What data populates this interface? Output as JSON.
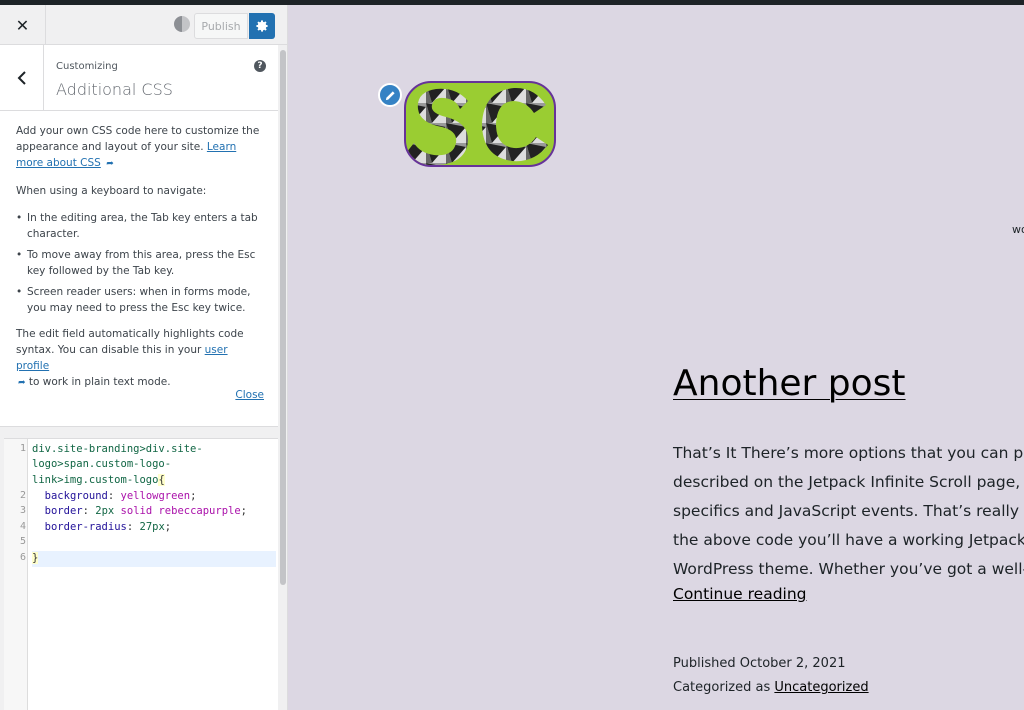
{
  "header": {
    "close_glyph": "✕",
    "publish_label": "Publish"
  },
  "section": {
    "breadcrumb": "Customizing",
    "title": "Additional CSS",
    "help_glyph": "?"
  },
  "description": {
    "intro": "Add your own CSS code here to customize the appearance and layout of your site.",
    "learn_more": "Learn more about CSS",
    "keyboard_heading": "When using a keyboard to navigate:",
    "bullets": [
      "In the editing area, the Tab key enters a tab character.",
      "To move away from this area, press the Esc key followed by the Tab key.",
      "Screen reader users: when in forms mode, you may need to press the Esc key twice."
    ],
    "highlight_text_1": "The edit field automatically highlights code syntax. You can disable this in your",
    "user_profile": "user profile",
    "highlight_text_2": "to work in plain text mode.",
    "close_link": "Close"
  },
  "editor": {
    "line_numbers": [
      "1",
      "2",
      "3",
      "4",
      "5",
      "6"
    ],
    "line1a": "div.site-branding>div.site-",
    "line1b": "logo>span.custom-logo-",
    "line1c": "link>img.custom-logo",
    "line2_prop": "background",
    "line2_val": "yellowgreen",
    "line3_prop": "border",
    "line3_num": "2px",
    "line3_val": "solid rebeccapurple",
    "line4_prop": "border-radius",
    "line4_num": "27px",
    "open_brace": "{",
    "close_brace": "}"
  },
  "preview": {
    "right_edge_text": "wo",
    "post_title": "Another post",
    "body_lines": [
      "That’s It There’s more options that you can pla",
      "described on the Jetpack Infinite Scroll page, ",
      "specifics and JavaScript events. That’s really a",
      "the above code you’ll have a working Jetpack",
      "WordPress theme. Whether you’ve got a well-"
    ],
    "continue_reading": "Continue reading",
    "published": "Published October 2, 2021",
    "categorized_prefix": "Categorized as",
    "category": "Uncategorized"
  },
  "colors": {
    "accent": "#2271b1",
    "preview_bg": "#dcd7e3",
    "logo_bg": "yellowgreen",
    "logo_border": "rebeccapurple"
  }
}
